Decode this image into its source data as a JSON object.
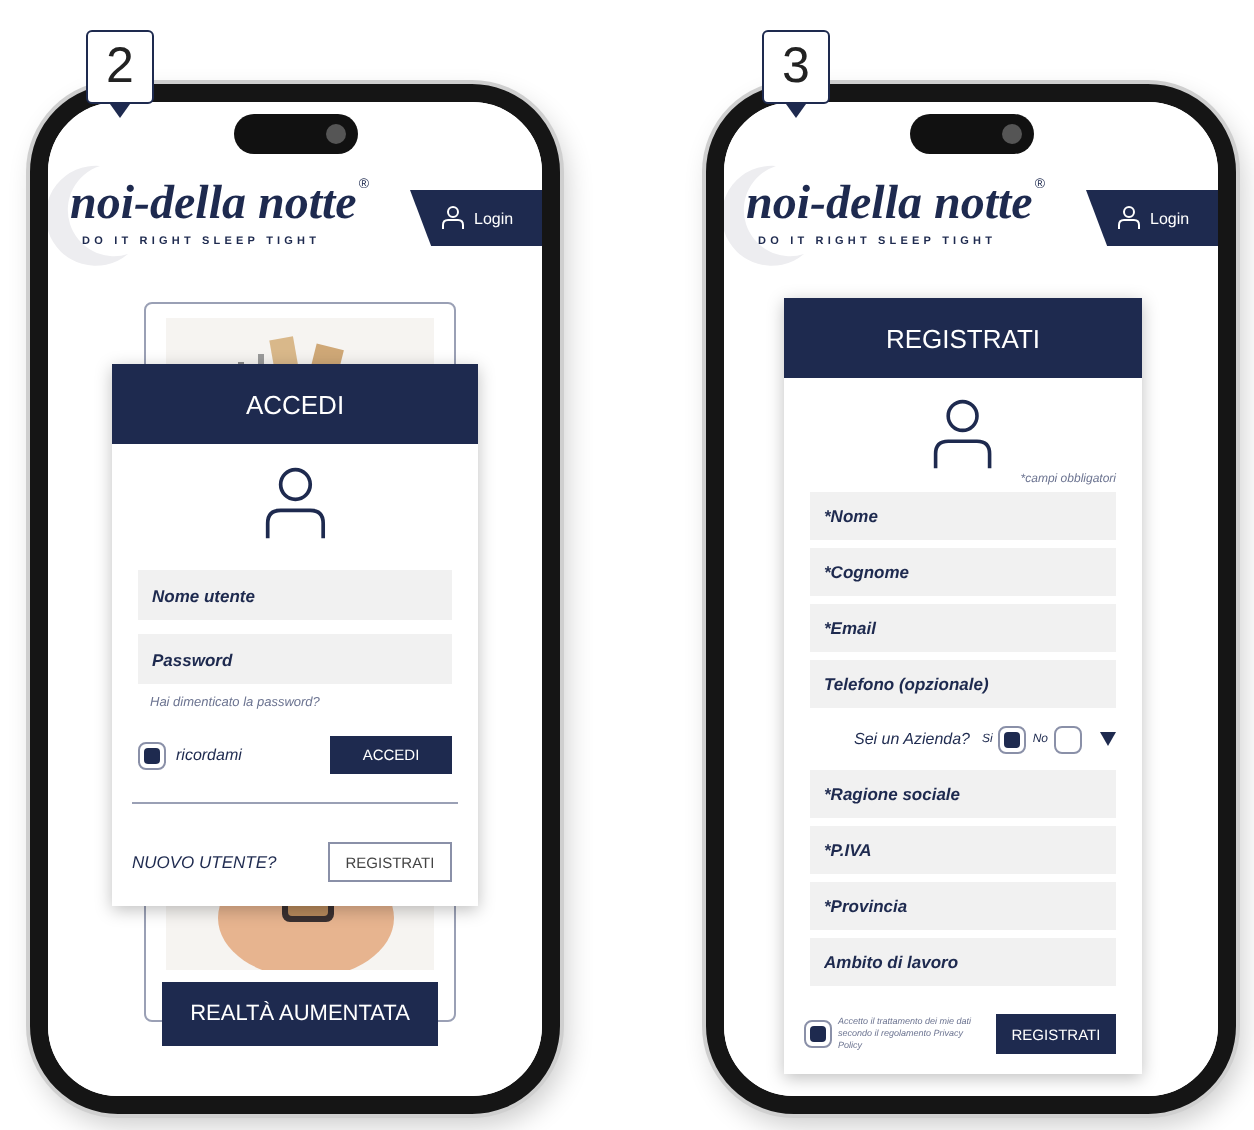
{
  "login_screen": {
    "step": "2",
    "header": {
      "logo": "noi-della notte",
      "registered": "®",
      "tagline": "DO IT RIGHT SLEEP TIGHT",
      "login": "Login"
    },
    "background_card": {
      "kind": "picture",
      "button": "REALTÀ AUMENTATA"
    },
    "login_card": {
      "title": "ACCEDI",
      "fields": [
        {
          "placeholder": "Nome utente"
        },
        {
          "placeholder": "Password"
        }
      ],
      "forgot": "Hai dimenticato la password?",
      "remember": {
        "label": "ricordami",
        "checked": true
      },
      "submit": "ACCEDI",
      "new_user": "NUOVO UTENTE?",
      "register": "REGISTRATI"
    }
  },
  "register_screen": {
    "step": "3",
    "header": {
      "logo": "noi-della notte",
      "registered": "®",
      "tagline": "DO IT RIGHT SLEEP TIGHT",
      "login": "Login"
    },
    "register_card": {
      "title": "REGISTRATI",
      "note": "*campi obbligatori",
      "fields": [
        {
          "placeholder": "*Nome"
        },
        {
          "placeholder": "*Cognome"
        },
        {
          "placeholder": "*Email"
        },
        {
          "placeholder": "Telefono (opzionale)"
        }
      ],
      "company_question": {
        "label": "Sei un Azienda?",
        "options": [
          {
            "label": "Si",
            "selected": true
          },
          {
            "label": "No",
            "selected": false
          }
        ]
      },
      "company_fields": [
        {
          "placeholder": "*Ragione sociale"
        },
        {
          "placeholder": "*P.IVA"
        },
        {
          "placeholder": "*Provincia"
        },
        {
          "placeholder": "Ambito di lavoro"
        }
      ],
      "consent": {
        "text": "Accetto il trattamento dei mie dati secondo il regolamento Privacy Policy",
        "checked": true
      },
      "submit": "REGISTRATI"
    }
  }
}
